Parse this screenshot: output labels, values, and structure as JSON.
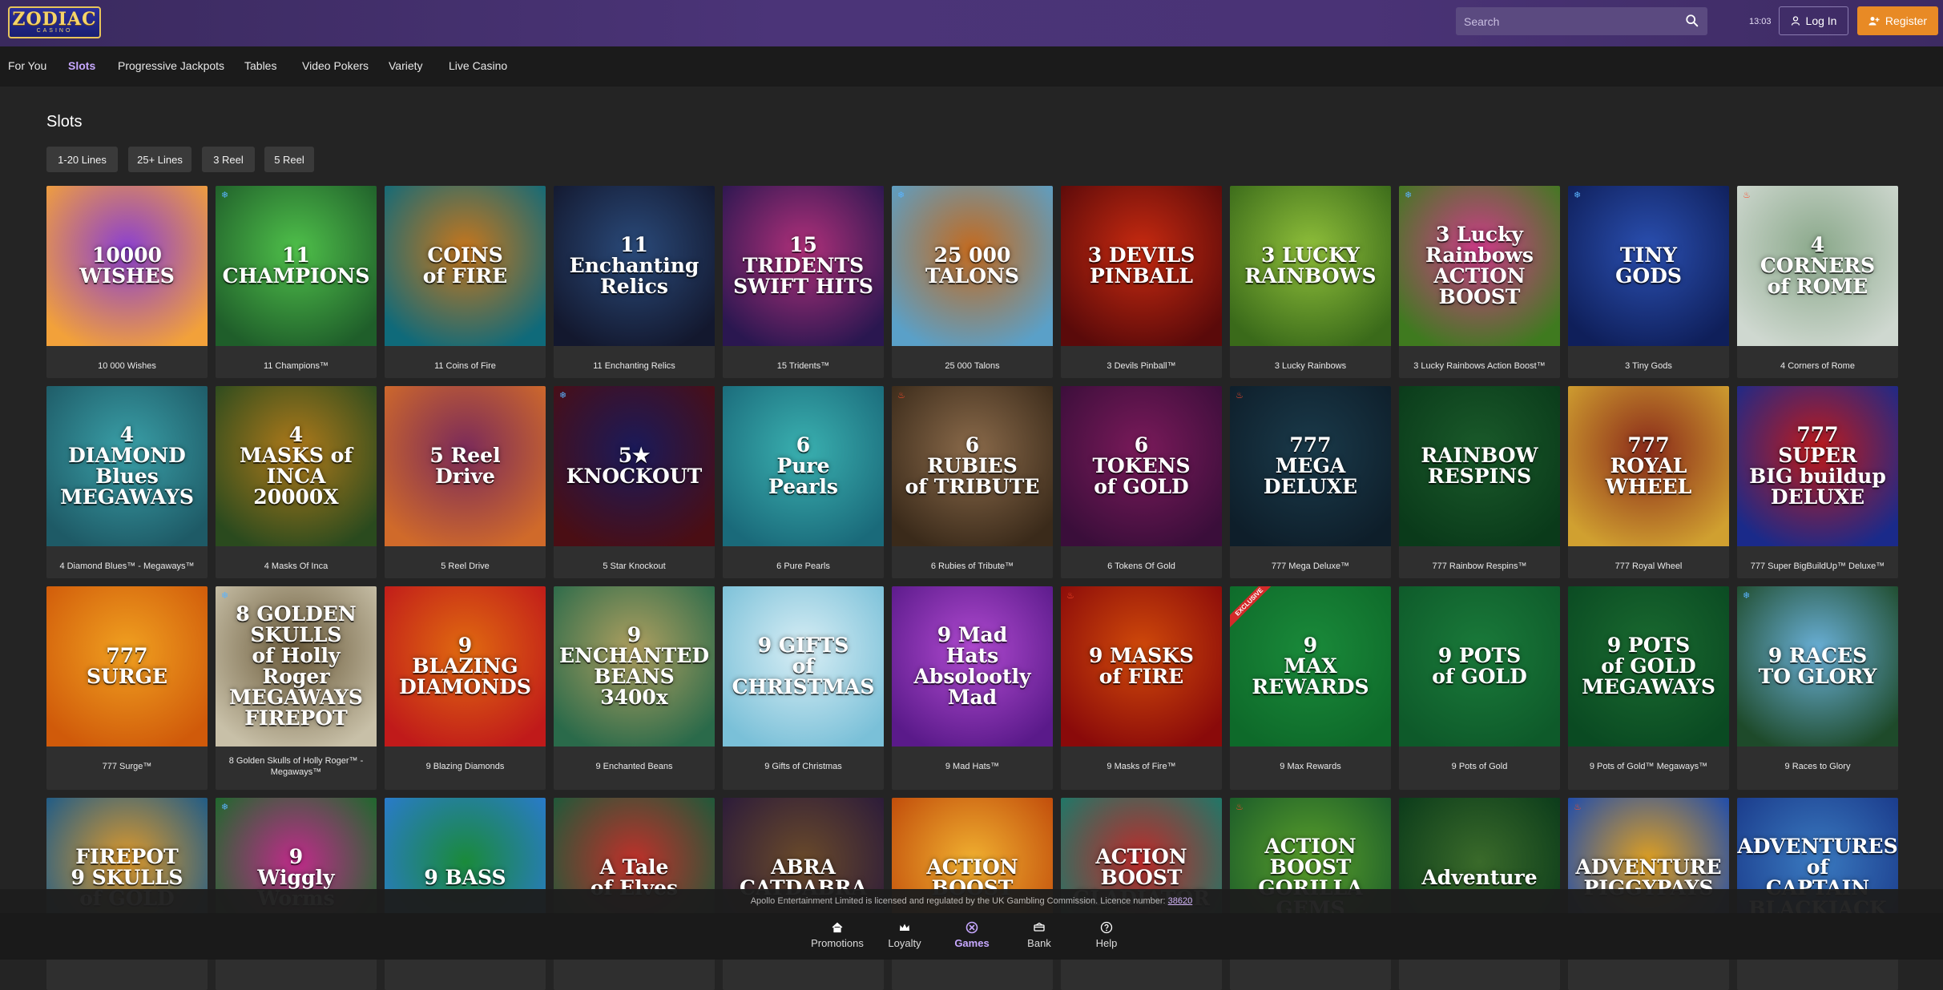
{
  "brand": {
    "logo_main": "ZODIAC",
    "logo_sub": "CASINO"
  },
  "header": {
    "search_placeholder": "Search",
    "time": "13:03",
    "login_label": "Log In",
    "register_label": "Register",
    "accent_color": "#e88a25"
  },
  "nav": {
    "items": [
      {
        "label": "For You",
        "active": false
      },
      {
        "label": "Slots",
        "active": true
      },
      {
        "label": "Progressive Jackpots",
        "active": false
      },
      {
        "label": "Tables",
        "active": false
      },
      {
        "label": "Video Pokers",
        "active": false
      },
      {
        "label": "Variety",
        "active": false
      },
      {
        "label": "Live Casino",
        "active": false
      }
    ]
  },
  "section": {
    "title": "Slots",
    "filters": [
      "1-20 Lines",
      "25+ Lines",
      "3 Reel",
      "5 Reel"
    ]
  },
  "games": [
    {
      "label": "10 000 Wishes",
      "art": "10000\nWISHES",
      "bg": [
        "#f2a13a",
        "#8a3fd1"
      ],
      "badge": ""
    },
    {
      "label": "11 Champions™",
      "art": "11\nCHAMPIONS",
      "bg": [
        "#1f5e2a",
        "#4fc04a"
      ],
      "badge": "snow"
    },
    {
      "label": "11 Coins of Fire",
      "art": "COINS\nof FIRE",
      "bg": [
        "#0f6a7a",
        "#c7761c"
      ],
      "badge": ""
    },
    {
      "label": "11 Enchanting Relics",
      "art": "11\nEnchanting\nRelics",
      "bg": [
        "#13182e",
        "#2a4a7a"
      ],
      "badge": ""
    },
    {
      "label": "15 Tridents™",
      "art": "15\nTRIDENTS\nSWIFT HITS",
      "bg": [
        "#2a1750",
        "#b0307a"
      ],
      "badge": ""
    },
    {
      "label": "25 000 Talons",
      "art": "25 000\nTALONS",
      "bg": [
        "#5aa0c8",
        "#c46a1e"
      ],
      "badge": "snow"
    },
    {
      "label": "3 Devils Pinball™",
      "art": "3 DEVILS\nPINBALL",
      "bg": [
        "#5a0a0a",
        "#c72a10"
      ],
      "badge": ""
    },
    {
      "label": "3 Lucky Rainbows",
      "art": "3 LUCKY\nRAINBOWS",
      "bg": [
        "#3a6a1a",
        "#8fbf3a"
      ],
      "badge": ""
    },
    {
      "label": "3 Lucky Rainbows Action Boost™",
      "art": "3 Lucky\nRainbows\nACTION BOOST",
      "bg": [
        "#3f7a1f",
        "#d03a8a"
      ],
      "badge": "snow"
    },
    {
      "label": "3 Tiny Gods",
      "art": "TINY\nGODS",
      "bg": [
        "#0f1f5a",
        "#2a4fb0"
      ],
      "badge": "snow"
    },
    {
      "label": "4 Corners of Rome",
      "art": "4\nCORNERS\nof ROME",
      "bg": [
        "#cfd8d0",
        "#8aa88a"
      ],
      "badge": "fire"
    },
    {
      "label": "4 Diamond Blues™ - Megaways™",
      "art": "4\nDIAMOND\nBlues\nMEGAWAYS",
      "bg": [
        "#1e5a66",
        "#3aa0a8"
      ],
      "badge": ""
    },
    {
      "label": "4 Masks Of Inca",
      "art": "4\nMASKS of\nINCA\n20000X",
      "bg": [
        "#2a4a1e",
        "#b07a1a"
      ],
      "badge": ""
    },
    {
      "label": "5 Reel Drive",
      "art": "5 Reel\nDrive",
      "bg": [
        "#d06a2a",
        "#7a2a5a"
      ],
      "badge": ""
    },
    {
      "label": "5 Star Knockout",
      "art": "5★\nKNOCKOUT",
      "bg": [
        "#4a0e14",
        "#1a1a5a"
      ],
      "badge": "snow"
    },
    {
      "label": "6 Pure Pearls",
      "art": "6\nPure\nPearls",
      "bg": [
        "#1a6a7a",
        "#3ab0b0"
      ],
      "badge": ""
    },
    {
      "label": "6 Rubies of Tribute™",
      "art": "6\nRUBIES\nof TRIBUTE",
      "bg": [
        "#3a2a1a",
        "#8a6a4a"
      ],
      "badge": "fire"
    },
    {
      "label": "6 Tokens Of Gold",
      "art": "6\nTOKENS\nof GOLD",
      "bg": [
        "#3a0e3a",
        "#7a1a5a"
      ],
      "badge": ""
    },
    {
      "label": "777 Mega Deluxe™",
      "art": "777\nMEGA\nDELUXE",
      "bg": [
        "#0e1e2a",
        "#1a3a4a"
      ],
      "badge": "fire"
    },
    {
      "label": "777 Rainbow Respins™",
      "art": "RAINBOW\nRESPINS",
      "bg": [
        "#0a3a1a",
        "#1a5a2a"
      ],
      "badge": ""
    },
    {
      "label": "777 Royal Wheel",
      "art": "777\nROYAL WHEEL",
      "bg": [
        "#d0a030",
        "#8a2a1a"
      ],
      "badge": ""
    },
    {
      "label": "777 Super BigBuildUp™ Deluxe™",
      "art": "777\nSUPER\nBIG buildup\nDELUXE",
      "bg": [
        "#1a2a8a",
        "#c01a1a"
      ],
      "badge": ""
    },
    {
      "label": "777 Surge™",
      "art": "777\nSURGE",
      "bg": [
        "#d05a0a",
        "#f0a020"
      ],
      "badge": ""
    },
    {
      "label": "8 Golden Skulls of Holly Roger™ - Megaways™",
      "art": "8 GOLDEN SKULLS\nof Holly Roger\nMEGAWAYS\nFIREPOT",
      "bg": [
        "#c8c0a8",
        "#6a5a3a"
      ],
      "badge": "snow"
    },
    {
      "label": "9 Blazing Diamonds",
      "art": "9\nBLAZING\nDIAMONDS",
      "bg": [
        "#c01a1a",
        "#e06a10"
      ],
      "badge": ""
    },
    {
      "label": "9 Enchanted Beans",
      "art": "9\nENCHANTED\nBEANS\n3400x",
      "bg": [
        "#2a6a4a",
        "#b0a060"
      ],
      "badge": ""
    },
    {
      "label": "9 Gifts of Christmas",
      "art": "9 GIFTS\nof CHRISTMAS",
      "bg": [
        "#7ac0d8",
        "#d8eef5"
      ],
      "badge": ""
    },
    {
      "label": "9 Mad Hats™",
      "art": "9 Mad\nHats\nAbsolootly Mad",
      "bg": [
        "#5a1a8a",
        "#b04ad0"
      ],
      "badge": ""
    },
    {
      "label": "9 Masks of Fire™",
      "art": "9 MASKS\nof FIRE",
      "bg": [
        "#8a0a0a",
        "#d04a0a"
      ],
      "badge": "fire"
    },
    {
      "label": "9 Max Rewards",
      "art": "9\nMAX\nREWARDS",
      "bg": [
        "#0e6a2a",
        "#1a8a3a"
      ],
      "badge": "exclusive"
    },
    {
      "label": "9 Pots of Gold",
      "art": "9 POTS\nof GOLD",
      "bg": [
        "#0e5a2a",
        "#1a7a3a"
      ],
      "badge": ""
    },
    {
      "label": "9 Pots of Gold™ Megaways™",
      "art": "9 POTS\nof GOLD\nMEGAWAYS",
      "bg": [
        "#0a4a22",
        "#1a6a30"
      ],
      "badge": ""
    },
    {
      "label": "9 Races to Glory",
      "art": "9 RACES\nTO GLORY",
      "bg": [
        "#1e4a2a",
        "#6ab0d8"
      ],
      "badge": "snow"
    },
    {
      "label": "",
      "art": "FIREPOT\n9 SKULLS\nof GOLD",
      "bg": [
        "#1a5a8a",
        "#e09a2a"
      ],
      "badge": ""
    },
    {
      "label": "",
      "art": "9\nWiggly\nWorms",
      "bg": [
        "#1a6a2a",
        "#c02a8a"
      ],
      "badge": "snow"
    },
    {
      "label": "",
      "art": "9 BASS",
      "bg": [
        "#2a7ad0",
        "#1a8a3a"
      ],
      "badge": ""
    },
    {
      "label": "",
      "art": "A Tale\nof Elves",
      "bg": [
        "#1a5a3a",
        "#c0302a"
      ],
      "badge": ""
    },
    {
      "label": "",
      "art": "ABRA\nCATDABRA",
      "bg": [
        "#2a1a3a",
        "#6a4a2a"
      ],
      "badge": ""
    },
    {
      "label": "",
      "art": "ACTION BOOST",
      "bg": [
        "#c04a0a",
        "#f0b030"
      ],
      "badge": ""
    },
    {
      "label": "",
      "art": "ACTION BOOST\nGLADIATOR",
      "bg": [
        "#1a7a6a",
        "#c02a2a"
      ],
      "badge": ""
    },
    {
      "label": "",
      "art": "ACTION BOOST\nGORILLA\nGEMS",
      "bg": [
        "#1a5a2a",
        "#5aa02a"
      ],
      "badge": "fire"
    },
    {
      "label": "",
      "art": "Adventure",
      "bg": [
        "#0a3a1a",
        "#3a6a2a"
      ],
      "badge": ""
    },
    {
      "label": "",
      "art": "ADVENTURE\nPIGGYPAYS",
      "bg": [
        "#1a4ab0",
        "#e0a020"
      ],
      "badge": "fire"
    },
    {
      "label": "",
      "art": "ADVENTURES\nof\nCAPTAIN\nBLACKJACK",
      "bg": [
        "#1a3a8a",
        "#3a7ac0"
      ],
      "badge": ""
    }
  ],
  "footer": {
    "disclaimer": "Apollo Entertainment Limited is licensed and regulated by the UK Gambling Commission. Licence number:",
    "licence_number": "38620",
    "bottom_nav": [
      {
        "label": "Promotions",
        "icon": "home-icon",
        "active": false
      },
      {
        "label": "Loyalty",
        "icon": "crown-icon",
        "active": false
      },
      {
        "label": "Games",
        "icon": "games-icon",
        "active": true
      },
      {
        "label": "Bank",
        "icon": "bank-icon",
        "active": false
      },
      {
        "label": "Help",
        "icon": "help-icon",
        "active": false
      }
    ]
  }
}
